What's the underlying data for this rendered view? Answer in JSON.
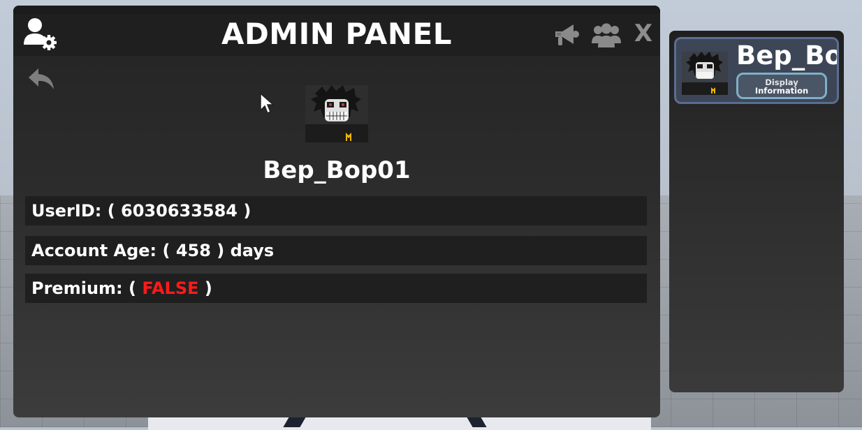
{
  "panel": {
    "title": "ADMIN PANEL",
    "close_label": "X",
    "player_name": "Bep_Bop01",
    "rows": {
      "user_id": {
        "label": "UserID: ( ",
        "value": "6030633584",
        "suffix": " )"
      },
      "account_age": {
        "label": "Account Age: ( ",
        "value": "458",
        "suffix": " ) days"
      },
      "premium": {
        "label": "Premium: ( ",
        "value": "FALSE",
        "suffix": " )",
        "value_color": "#ff1a1a"
      }
    },
    "icons": {
      "admin": "admin-settings-icon",
      "megaphone": "megaphone-icon",
      "group": "group-icon",
      "back": "back-arrow-icon"
    }
  },
  "sidebar": {
    "players": [
      {
        "name": "Bep_Bop",
        "button_line1": "Display",
        "button_line2": "Information"
      }
    ],
    "accent_border": "#5a6e92",
    "button_border": "#7fb0c8"
  }
}
